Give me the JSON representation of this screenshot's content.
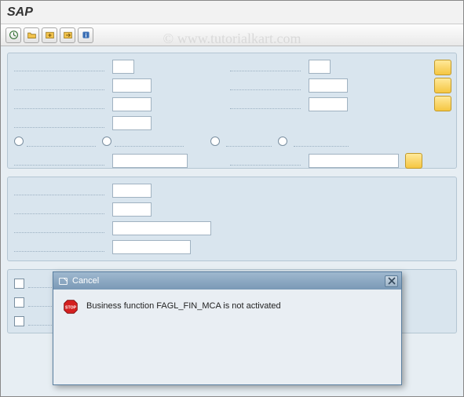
{
  "title": "SAP",
  "watermark": "© www.tutorialkart.com",
  "toolbar": {
    "icons": [
      "execute",
      "variant-get",
      "variant-save",
      "variant-delete",
      "info"
    ]
  },
  "dialog": {
    "title": "Cancel",
    "message": "Business function FAGL_FIN_MCA is not activated"
  }
}
